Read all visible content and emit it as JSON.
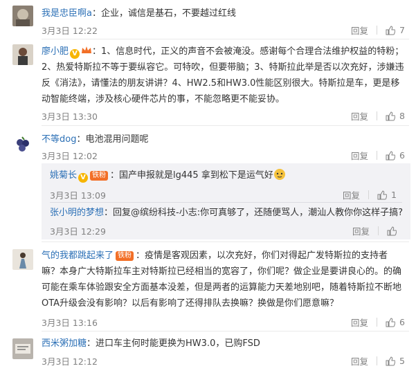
{
  "comments": [
    {
      "user": "我是忠臣啊a",
      "colon": "：",
      "text": "企业，诚信是基石，不要越过红线",
      "time": "3月3日 12:22",
      "reply": "回复",
      "likes": "7"
    },
    {
      "user": "廖小肥",
      "text": "：1、信息时代，正义的声音不会被淹没。感谢每个合理合法维护权益的特粉；2、热爱特斯拉不等于要纵容它。可特吹，但要带脑；3、特斯拉此举是否以次充好，涉嫌违反《消法》，请懂法的朋友讲讲？4、HW2.5和HW3.0性能区别很大。特斯拉是车，更是移动智能终端，涉及核心硬件芯片的事，不能忽略更不能妥协。",
      "time": "3月3日 13:30",
      "reply": "回复",
      "likes": "8"
    },
    {
      "user": "不等dog",
      "colon": "：",
      "text": "电池混用问题呢",
      "time": "3月3日 12:02",
      "reply": "回复",
      "likes": "6",
      "replies": [
        {
          "user": "姚菊长",
          "badge": "铁粉",
          "text": "：国产申报就是lg445 拿到松下是运气好",
          "time": "3月3日 13:09",
          "reply": "回复",
          "likes": "1"
        },
        {
          "user": "张小明的梦想",
          "text": "：回复@缤纷科技-小志:你可真够了，还随便骂人，潮汕人教你你这样子搞?",
          "time": "3月3日 12:29",
          "reply": "回复"
        }
      ]
    },
    {
      "user": "气的我都跳起来了",
      "badge": "铁粉",
      "text": "：疫情是客观因素，以次充好，你们对得起广发特斯拉的支持者嘛？本身广大特斯拉车主对特斯拉已经相当的宽容了，你们呢？做企业是要讲良心的。的确可能在乘车体验跟安全方面基本没差，但是两者的运算能力天差地别吧，随着特斯拉不断地OTA升级会没有影响？以后有影响了还得排队去换嘛？换做是你们愿意嘛？",
      "time": "3月3日 13:16",
      "reply": "回复",
      "likes": "6"
    },
    {
      "user": "西米粥加糖",
      "colon": "：",
      "text": "进口车主何时能更换为HW3.0，已购FSD",
      "time": "3月3日 12:12",
      "reply": "回复",
      "likes": "5"
    }
  ]
}
